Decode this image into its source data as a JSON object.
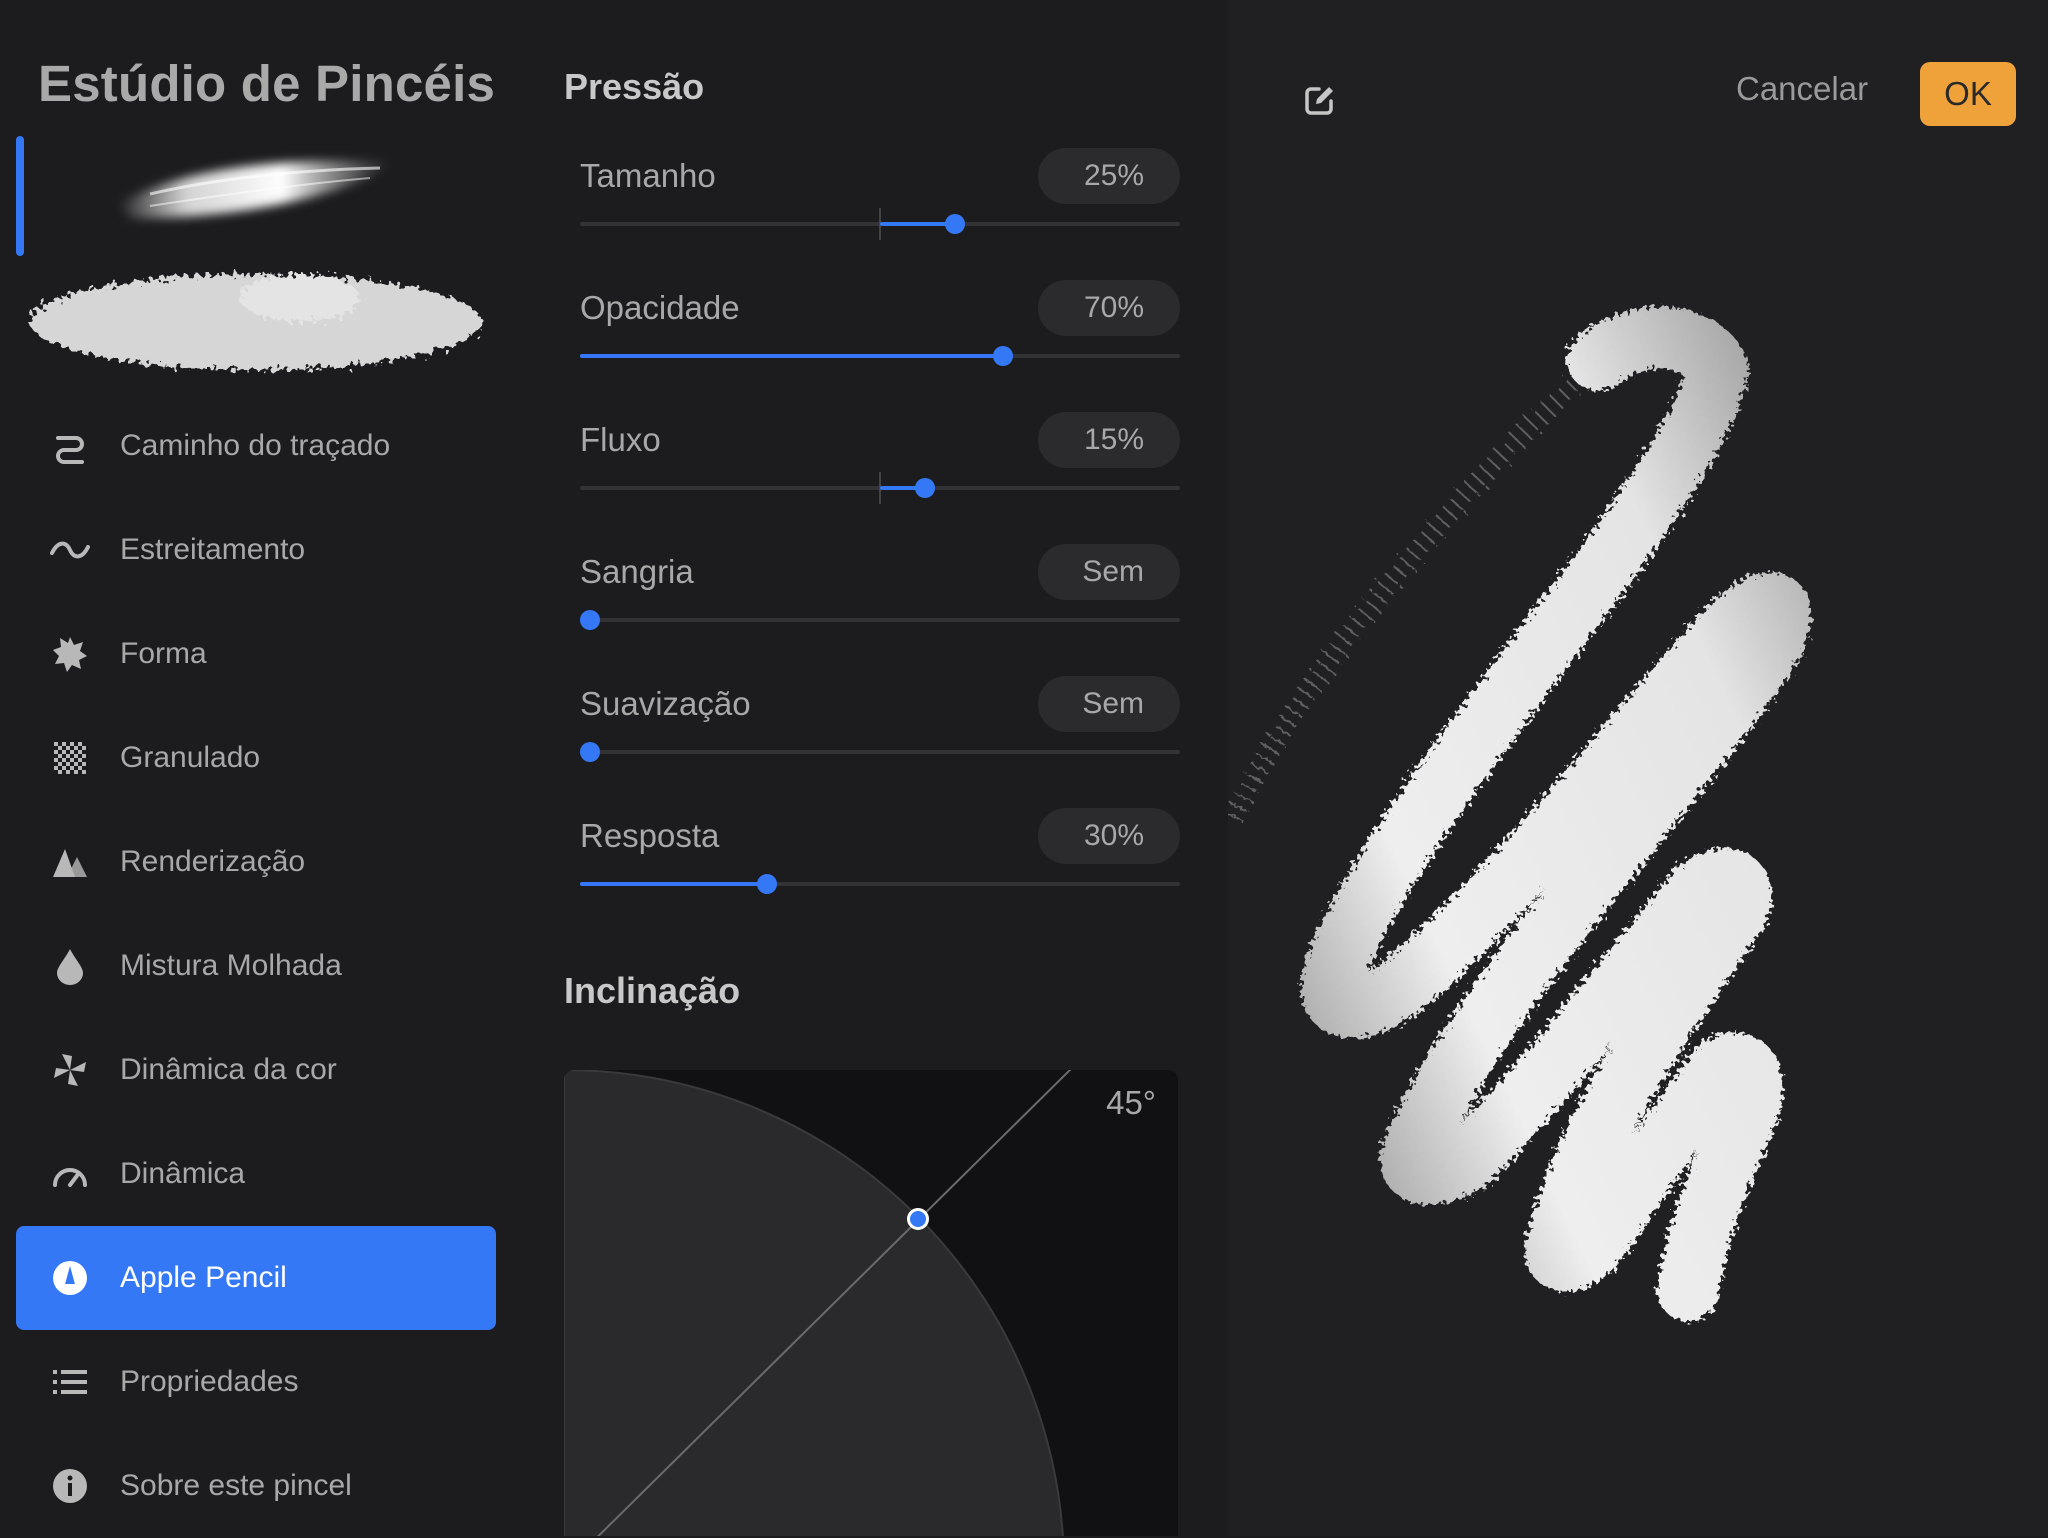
{
  "sidebar": {
    "title": "Estúdio de Pincéis",
    "menu": [
      {
        "label": "Caminho do traçado",
        "icon": "stroke-path-icon"
      },
      {
        "label": "Estreitamento",
        "icon": "taper-icon"
      },
      {
        "label": "Forma",
        "icon": "shape-icon"
      },
      {
        "label": "Granulado",
        "icon": "grain-icon"
      },
      {
        "label": "Renderização",
        "icon": "rendering-icon"
      },
      {
        "label": "Mistura Molhada",
        "icon": "wet-mix-icon"
      },
      {
        "label": "Dinâmica da cor",
        "icon": "color-dynamics-icon"
      },
      {
        "label": "Dinâmica",
        "icon": "dynamics-icon"
      },
      {
        "label": "Apple Pencil",
        "icon": "apple-pencil-icon",
        "active": true
      },
      {
        "label": "Propriedades",
        "icon": "properties-icon"
      },
      {
        "label": "Sobre este pincel",
        "icon": "info-icon"
      }
    ]
  },
  "panel": {
    "pressure_title": "Pressão",
    "sliders": [
      {
        "name": "Tamanho",
        "value": "25%",
        "level": 0.25,
        "bipolar": true
      },
      {
        "name": "Opacidade",
        "value": "70%",
        "level": 0.7,
        "bipolar": false
      },
      {
        "name": "Fluxo",
        "value": "15%",
        "level": 0.15,
        "bipolar": true
      },
      {
        "name": "Sangria",
        "value": "Sem",
        "level": 0.0,
        "bipolar": false
      },
      {
        "name": "Suavização",
        "value": "Sem",
        "level": 0.0,
        "bipolar": false
      },
      {
        "name": "Resposta",
        "value": "30%",
        "level": 0.3,
        "bipolar": false
      }
    ],
    "tilt_title": "Inclinação",
    "tilt_angle": "45°"
  },
  "toolbar": {
    "cancel_label": "Cancelar",
    "ok_label": "OK"
  },
  "colors": {
    "accent": "#3478f6",
    "ok_button": "#f0a23a",
    "background": "#1c1c1e"
  }
}
